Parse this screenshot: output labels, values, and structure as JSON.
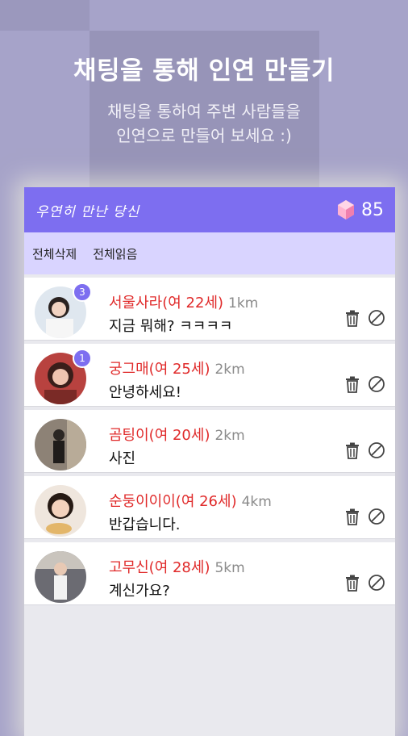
{
  "hero": {
    "title": "채팅을 통해 인연 만들기",
    "subtitle_line1": "채팅을 통하여 주변 사람들을",
    "subtitle_line2": "인연으로 만들어 보세요 :)"
  },
  "header": {
    "title": "우연히 만난 당신",
    "points": "85",
    "gem_icon": "gem-icon"
  },
  "toolbar": {
    "delete_all_label": "전체삭제",
    "read_all_label": "전체읽음"
  },
  "colors": {
    "accent": "#7d6ef0",
    "toolbar_bg": "#d9d4ff",
    "name_red": "#e02a2a",
    "page_bg": "#a6a3c9"
  },
  "chats": [
    {
      "name": "서울사라(여 22세)",
      "distance": "1km",
      "message": "지금 뭐해? ㅋㅋㅋㅋ",
      "badge": "3"
    },
    {
      "name": "궁그매(여 25세)",
      "distance": "2km",
      "message": "안녕하세요!",
      "badge": "1"
    },
    {
      "name": "곰팅이(여 20세)",
      "distance": "2km",
      "message": "사진",
      "badge": ""
    },
    {
      "name": "순둥이이이(여 26세)",
      "distance": "4km",
      "message": "반갑습니다.",
      "badge": ""
    },
    {
      "name": "고무신(여 28세)",
      "distance": "5km",
      "message": "계신가요?",
      "badge": ""
    }
  ]
}
